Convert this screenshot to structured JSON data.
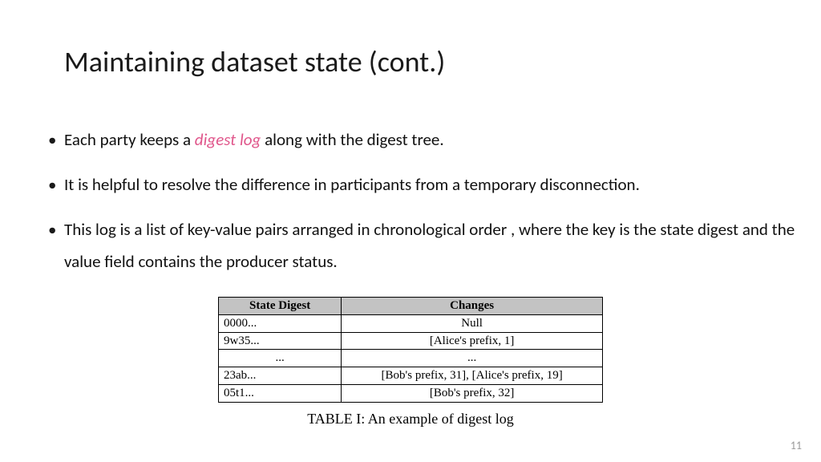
{
  "title": "Maintaining dataset state (cont.)",
  "bullets": {
    "b1a": "Each party keeps a ",
    "b1h": "digest log",
    "b1b": " along with the digest tree.",
    "b2": "It is helpful to resolve the difference in participants from a temporary disconnection.",
    "b3": "This log is a list of key-value pairs arranged in chronological order , where the key is the state digest and the value field contains the producer status."
  },
  "table": {
    "h1": "State Digest",
    "h2": "Changes",
    "rows": [
      {
        "digest": "0000...",
        "changes": "Null"
      },
      {
        "digest": "9w35...",
        "changes": "[Alice's prefix, 1]"
      },
      {
        "digest": "...",
        "changes": "..."
      },
      {
        "digest": "23ab...",
        "changes": "[Bob's prefix, 31], [Alice's prefix, 19]"
      },
      {
        "digest": "05t1...",
        "changes": "[Bob's prefix, 32]"
      }
    ]
  },
  "caption": "TABLE I: An example of digest log",
  "page": "11"
}
